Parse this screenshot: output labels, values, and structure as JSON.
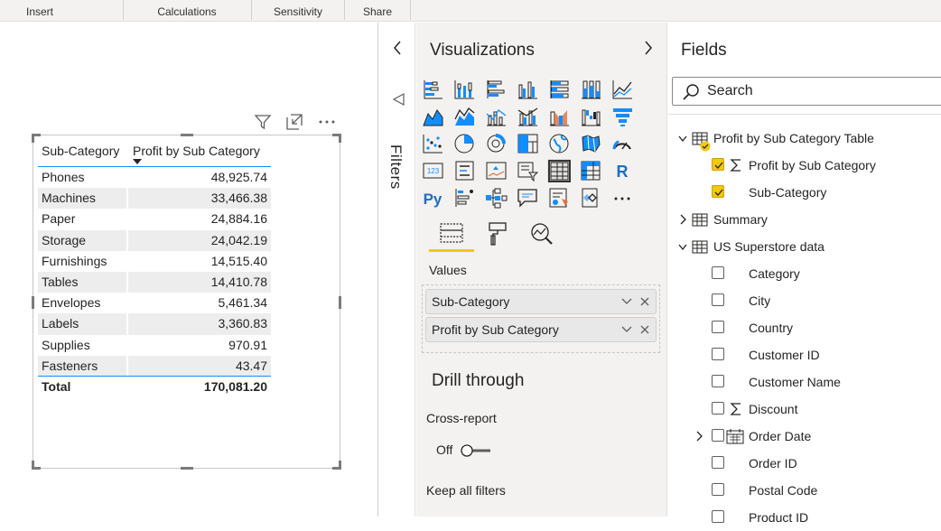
{
  "ribbon": {
    "tabs": [
      "Insert",
      "Calculations",
      "Sensitivity",
      "Share"
    ]
  },
  "table": {
    "headers": [
      "Sub-Category",
      "Profit by Sub Category"
    ],
    "rows": [
      [
        "Phones",
        "48,925.74"
      ],
      [
        "Machines",
        "33,466.38"
      ],
      [
        "Paper",
        "24,884.16"
      ],
      [
        "Storage",
        "24,042.19"
      ],
      [
        "Furnishings",
        "14,515.40"
      ],
      [
        "Tables",
        "14,410.78"
      ],
      [
        "Envelopes",
        "5,461.34"
      ],
      [
        "Labels",
        "3,360.83"
      ],
      [
        "Supplies",
        "970.91"
      ],
      [
        "Fasteners",
        "43.47"
      ]
    ],
    "total_label": "Total",
    "total_value": "170,081.20"
  },
  "filters": {
    "label": "Filters"
  },
  "visualizations": {
    "title": "Visualizations",
    "values_label": "Values",
    "value_fields": [
      "Sub-Category",
      "Profit by Sub Category"
    ],
    "drill_title": "Drill through",
    "cross_report_label": "Cross-report",
    "toggle_label": "Off",
    "keep_filters_label": "Keep all filters",
    "icon_names": [
      "stacked-bar-icon",
      "stacked-column-icon",
      "clustered-bar-icon",
      "clustered-column-icon",
      "100-bar-icon",
      "100-column-icon",
      "line-chart-icon",
      "area-chart-icon",
      "stacked-area-icon",
      "line-column-icon",
      "line-clustered-column-icon",
      "ribbon-chart-icon",
      "waterfall-icon",
      "funnel-icon",
      "scatter-icon",
      "pie-icon",
      "donut-icon",
      "treemap-icon",
      "map-icon",
      "filled-map-icon",
      "gauge-icon",
      "card-icon",
      "multirow-card-icon",
      "kpi-icon",
      "slicer-icon",
      "table-icon",
      "matrix-icon",
      "r-visual-icon",
      "python-visual-icon",
      "key-influencers-icon",
      "decomposition-tree-icon",
      "qa-icon",
      "smart-narrative-icon",
      "paginated-icon",
      "more-visuals-icon"
    ]
  },
  "fields": {
    "title": "Fields",
    "search_placeholder": "Search",
    "items": [
      {
        "label": "Profit by Sub Category Table",
        "kind": "table",
        "expanded": true
      },
      {
        "label": "Profit by Sub Category",
        "kind": "measure",
        "checked": true
      },
      {
        "label": "Sub-Category",
        "kind": "column",
        "checked": true
      },
      {
        "label": "Summary",
        "kind": "table",
        "expanded": false
      },
      {
        "label": "US Superstore data",
        "kind": "table",
        "expanded": true
      },
      {
        "label": "Category",
        "kind": "column",
        "checked": false
      },
      {
        "label": "City",
        "kind": "column",
        "checked": false
      },
      {
        "label": "Country",
        "kind": "column",
        "checked": false
      },
      {
        "label": "Customer ID",
        "kind": "column",
        "checked": false
      },
      {
        "label": "Customer Name",
        "kind": "column",
        "checked": false
      },
      {
        "label": "Discount",
        "kind": "sum",
        "checked": false
      },
      {
        "label": "Order Date",
        "kind": "date",
        "checked": false
      },
      {
        "label": "Order ID",
        "kind": "column",
        "checked": false
      },
      {
        "label": "Postal Code",
        "kind": "column",
        "checked": false
      },
      {
        "label": "Product ID",
        "kind": "column",
        "checked": false
      }
    ]
  },
  "colors": {
    "accent": "#f2c811",
    "table_line": "#118dff",
    "pane_bg": "#f3f2f1"
  }
}
